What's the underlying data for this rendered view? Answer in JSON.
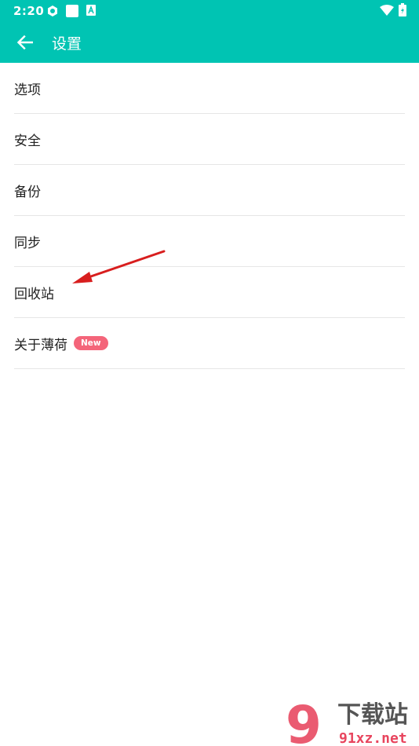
{
  "status_bar": {
    "time": "2:20",
    "icons_left": [
      "sync-icon",
      "square-icon",
      "text-a-icon"
    ],
    "icons_right": [
      "wifi-icon",
      "battery-icon"
    ]
  },
  "toolbar": {
    "back_icon": "arrow-left-icon",
    "title": "设置",
    "background": "#00C4B3"
  },
  "settings": {
    "items": [
      {
        "label": "选项"
      },
      {
        "label": "安全"
      },
      {
        "label": "备份"
      },
      {
        "label": "同步"
      },
      {
        "label": "回收站"
      },
      {
        "label": "关于薄荷",
        "badge": "New"
      }
    ]
  },
  "annotation": {
    "type": "red-arrow",
    "points_to": "回收站",
    "color": "#D81E1E"
  },
  "watermark": {
    "number_mark": "9",
    "line1": "下载站",
    "line2": "91xz.net"
  }
}
